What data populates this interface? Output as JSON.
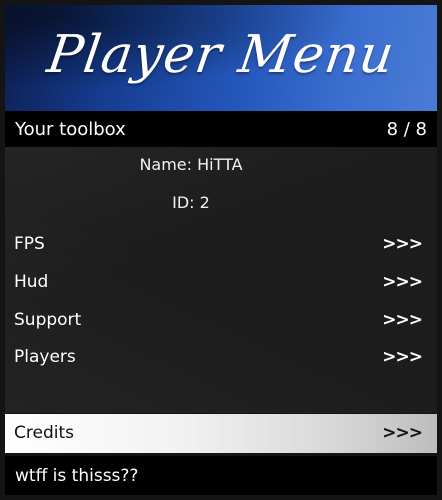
{
  "banner": {
    "title": "Player Menu"
  },
  "subheader": {
    "title": "Your toolbox",
    "counter": "8 / 8"
  },
  "info": {
    "name": "Name: HiTTA",
    "id": "ID: 2"
  },
  "items": [
    {
      "label": "FPS",
      "arrows": ">>>"
    },
    {
      "label": "Hud",
      "arrows": ">>>"
    },
    {
      "label": "Support",
      "arrows": ">>>"
    },
    {
      "label": "Players",
      "arrows": ">>>"
    }
  ],
  "selected": {
    "label": "Credits",
    "arrows": ">>>"
  },
  "footer": {
    "description": "wtff is thisss??"
  },
  "colors": {
    "banner_blue": "#2457bb",
    "header_black": "#000000",
    "selected_white": "#ffffff",
    "body_dark": "#1c1c1c"
  }
}
